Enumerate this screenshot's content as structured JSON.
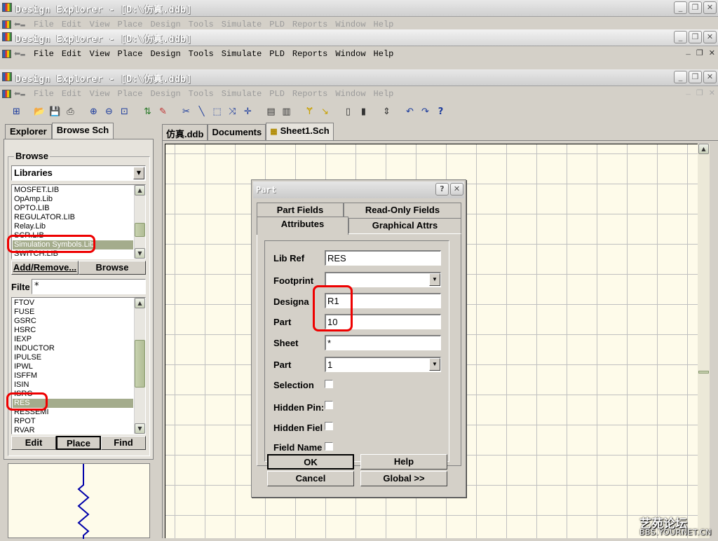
{
  "window": {
    "title": "Design Explorer - [D:\\仿真.ddb]"
  },
  "menu": {
    "items": [
      "File",
      "Edit",
      "View",
      "Place",
      "Design",
      "Tools",
      "Simulate",
      "PLD",
      "Reports",
      "Window",
      "Help"
    ]
  },
  "left_panel": {
    "tabs": [
      "Explorer",
      "Browse Sch"
    ],
    "active_tab": "Browse Sch",
    "browse_label": "Browse",
    "browse_select": "Libraries",
    "libraries": [
      "MOSFET.LIB",
      "OpAmp.Lib",
      "OPTO.LIB",
      "REGULATOR.LIB",
      "Relay.Lib",
      "SCR.LIB",
      "Simulation Symbols.Lib",
      "SWITCH.LIB"
    ],
    "selected_library": "Simulation Symbols.Lib",
    "add_remove_label": "Add/Remove...",
    "browse_button_label": "Browse",
    "filter_label": "Filte",
    "filter_value": "*",
    "components": [
      "FTOV",
      "FUSE",
      "GSRC",
      "HSRC",
      "IEXP",
      "INDUCTOR",
      "IPULSE",
      "IPWL",
      "ISFFM",
      "ISIN",
      "ISRC",
      "RES",
      "RESSEMI",
      "RPOT",
      "RVAR"
    ],
    "selected_component": "RES",
    "edit_label": "Edit",
    "place_label": "Place",
    "find_label": "Find"
  },
  "doc_tabs": [
    "仿真.ddb",
    "Documents",
    "Sheet1.Sch"
  ],
  "active_doc_tab": "Sheet1.Sch",
  "dialog": {
    "title": "Part",
    "tabs": [
      "Part Fields",
      "Read-Only Fields",
      "Attributes",
      "Graphical Attrs"
    ],
    "active_tab": "Attributes",
    "fields": {
      "lib_ref_label": "Lib Ref",
      "lib_ref_value": "RES",
      "footprint_label": "Footprint",
      "footprint_value": "",
      "designator_label": "Designa",
      "designator_value": "R1",
      "part_label": "Part",
      "part_value": "10",
      "sheet_label": "Sheet",
      "sheet_value": "*",
      "part_number_label": "Part",
      "part_number_value": "1",
      "selection_label": "Selection",
      "hidden_pins_label": "Hidden Pin:",
      "hidden_fields_label": "Hidden Fiel",
      "field_names_label": "Field Name"
    },
    "buttons": {
      "ok": "OK",
      "help": "Help",
      "cancel": "Cancel",
      "global": "Global >>"
    }
  },
  "watermark": {
    "line1": "艺苑论坛",
    "line2": "BBS.YOURNET.CN"
  },
  "colors": {
    "selection": "#a4ac8c",
    "highlight_marker": "#ee0000",
    "sheet_background": "#fefbea",
    "resistor_wire": "#0000aa"
  }
}
